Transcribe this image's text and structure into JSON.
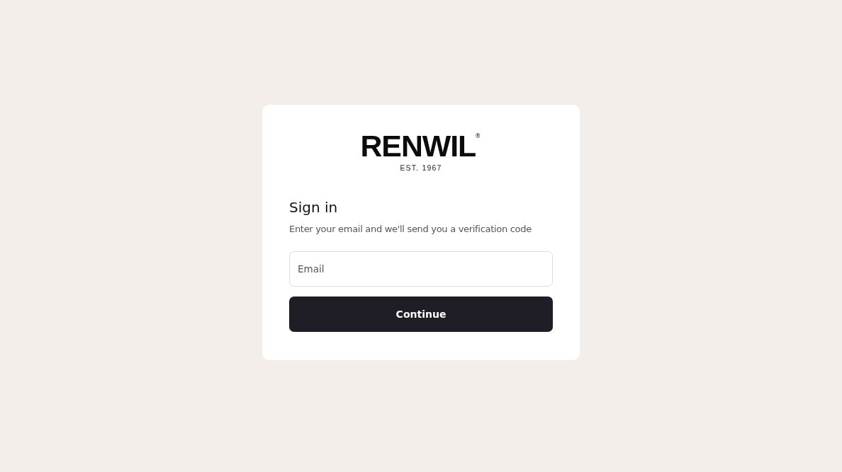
{
  "logo": {
    "wordmark": "RENWIL",
    "registered": "®",
    "tagline": "EST. 1967"
  },
  "heading": "Sign in",
  "subtitle": "Enter your email and we'll send you a verification code",
  "email_field": {
    "placeholder": "Email"
  },
  "buttons": [
    "Continue"
  ]
}
